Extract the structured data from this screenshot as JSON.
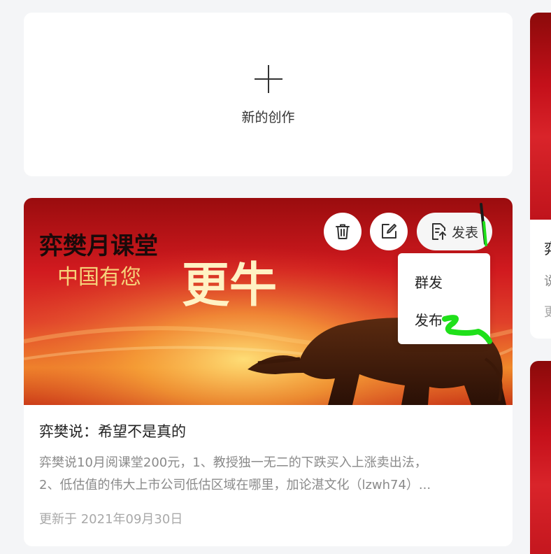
{
  "new_creation": {
    "label": "新的创作"
  },
  "article": {
    "cover_title_line1": "弈樊月课堂",
    "cover_title_line2": "中国有您",
    "cover_title_big": "更牛",
    "title": "弈樊说：希望不是真的",
    "description_line1": "弈樊说10月阅课堂200元，1、教授独一无二的下跌买入上涨卖出法，",
    "description_line2": "2、低估值的伟大上市公司低估区域在哪里，加论湛文化（lzwh74）...",
    "updated": "更新于 2021年09月30日"
  },
  "actions": {
    "publish_label": "发表",
    "dropdown": [
      "群发",
      "发布"
    ]
  },
  "side_card": {
    "title_char": "弈",
    "desc_char": "说",
    "date_char": "更"
  },
  "colors": {
    "accent_green": "#1fe01a",
    "page_bg": "#f4f5f7"
  },
  "icons": [
    "plus-icon",
    "trash-icon",
    "edit-icon",
    "publish-icon"
  ]
}
